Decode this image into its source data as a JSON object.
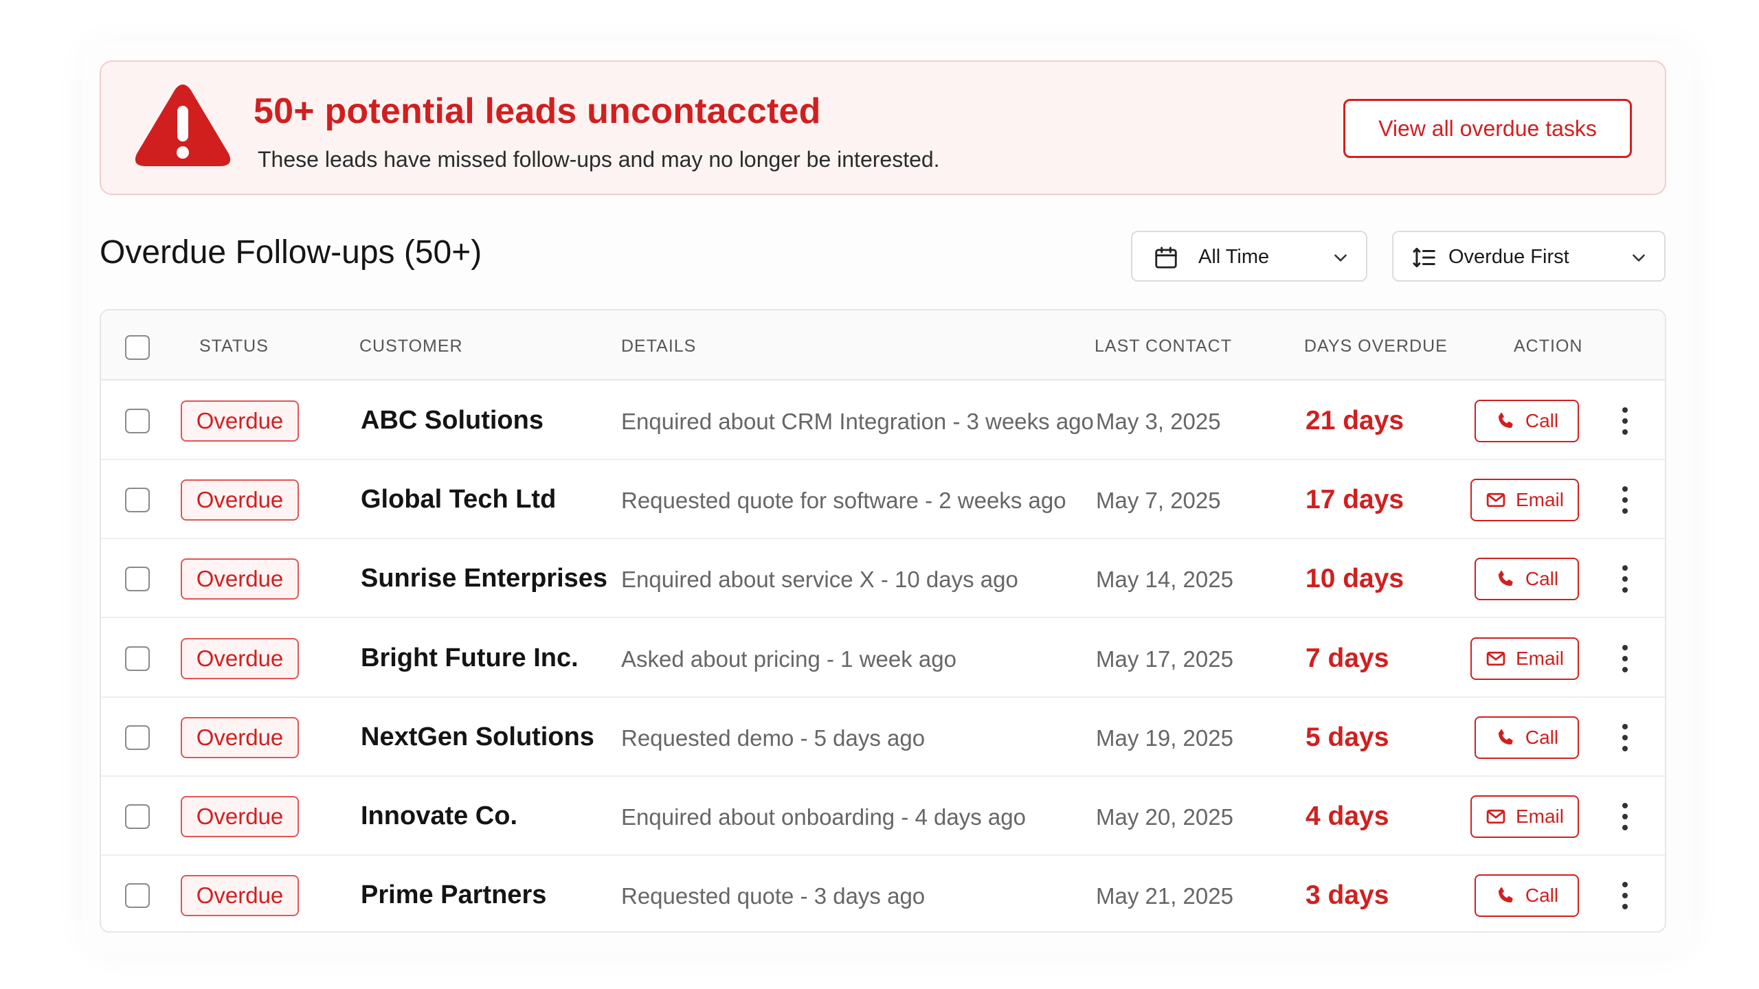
{
  "alert": {
    "title": "50+ potential leads uncontaccted",
    "subtitle": "These leads have missed follow-ups and may no longer be interested.",
    "button_label": "View all overdue tasks",
    "icon": "warning-triangle-icon"
  },
  "section": {
    "title": "Overdue Follow-ups (50+)"
  },
  "filters": {
    "time_selected": "All Time",
    "sort_selected": "Overdue First"
  },
  "table": {
    "headers": {
      "status": "Status",
      "customer": "Customer",
      "details": "Details",
      "last_contact": "Last Contact",
      "days_overdue": "Days Overdue",
      "action": "Action"
    },
    "rows": [
      {
        "status": "Overdue",
        "customer": "ABC Solutions",
        "details": "Enquired about CRM Integration - 3 weeks ago",
        "last_contact": "May 3, 2025",
        "days_overdue": "21 days",
        "action": "Call"
      },
      {
        "status": "Overdue",
        "customer": "Global Tech Ltd",
        "details": "Requested quote for software - 2 weeks ago",
        "last_contact": "May 7, 2025",
        "days_overdue": "17 days",
        "action": "Email"
      },
      {
        "status": "Overdue",
        "customer": "Sunrise Enterprises",
        "details": "Enquired about service X - 10 days ago",
        "last_contact": "May 14, 2025",
        "days_overdue": "10 days",
        "action": "Call"
      },
      {
        "status": "Overdue",
        "customer": "Bright Future Inc.",
        "details": "Asked about pricing - 1 week ago",
        "last_contact": "May 17, 2025",
        "days_overdue": "7 days",
        "action": "Email"
      },
      {
        "status": "Overdue",
        "customer": "NextGen Solutions",
        "details": "Requested demo - 5 days ago",
        "last_contact": "May 19, 2025",
        "days_overdue": "5 days",
        "action": "Call"
      },
      {
        "status": "Overdue",
        "customer": "Innovate Co.",
        "details": "Enquired about onboarding - 4 days ago",
        "last_contact": "May 20, 2025",
        "days_overdue": "4 days",
        "action": "Email"
      },
      {
        "status": "Overdue",
        "customer": "Prime Partners",
        "details": "Requested quote - 3 days ago",
        "last_contact": "May 21, 2025",
        "days_overdue": "3 days",
        "action": "Call"
      }
    ]
  },
  "colors": {
    "accent_red": "#d11f1f",
    "alert_bg": "#fdf3f3",
    "badge_bg": "#fff4f4"
  }
}
